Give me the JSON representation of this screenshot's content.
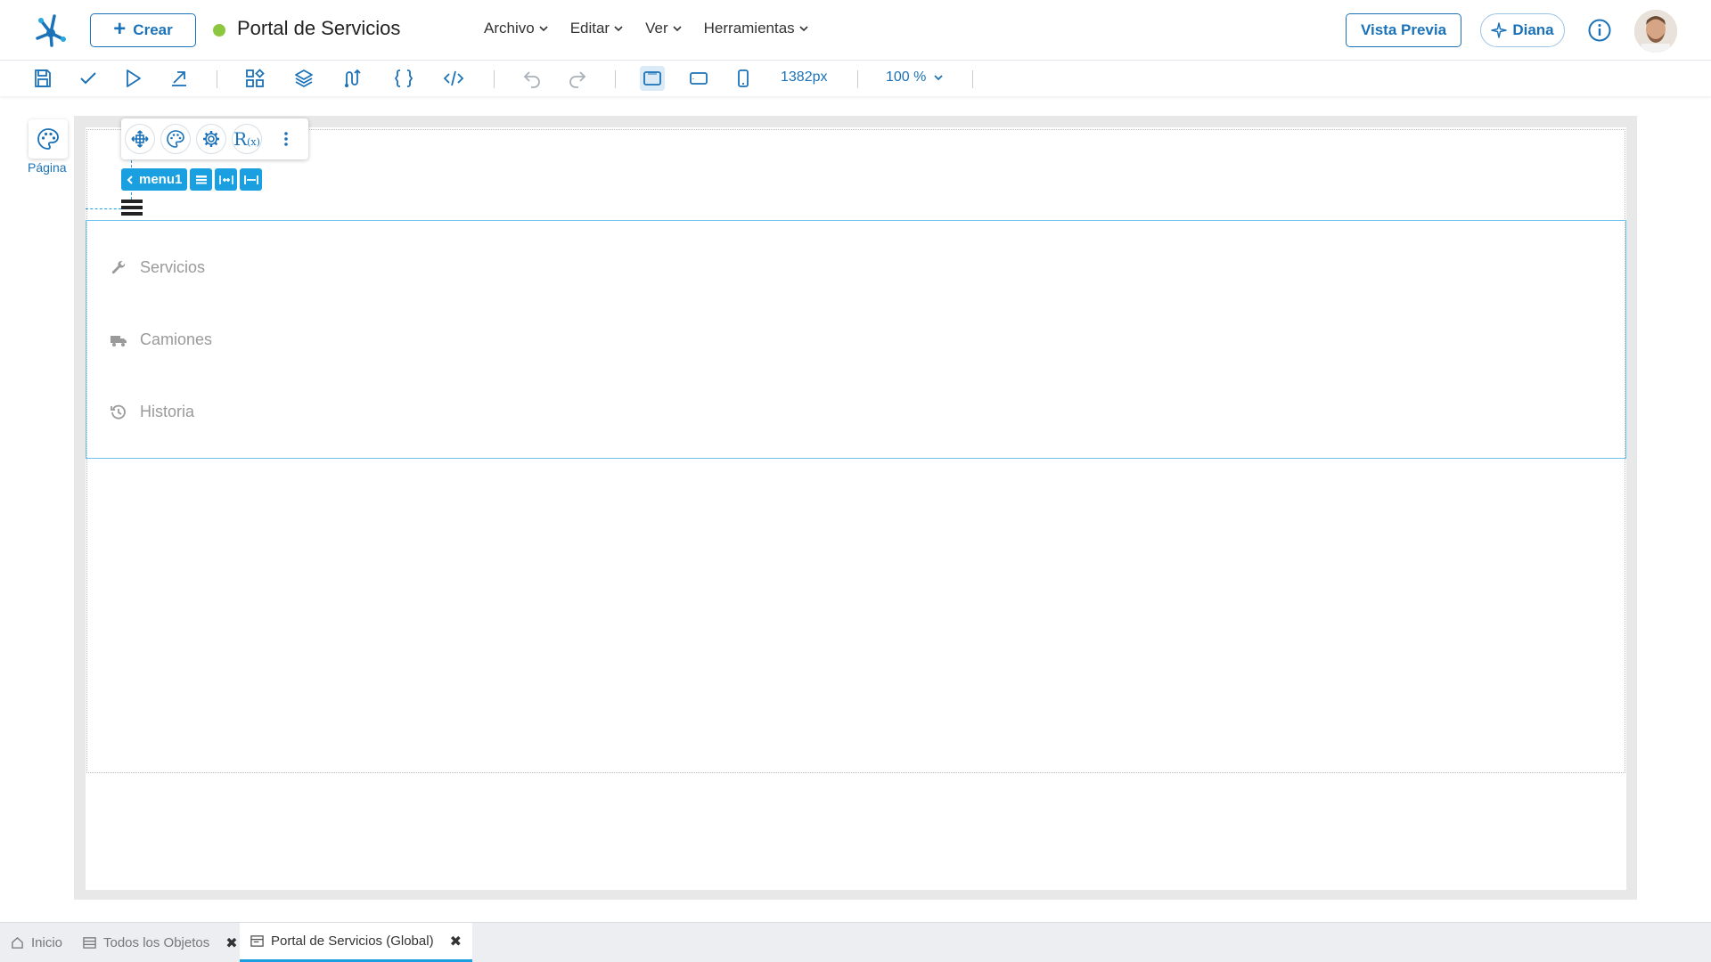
{
  "header": {
    "create_label": "Crear",
    "title": "Portal de Servicios",
    "status_color": "#8dc63f",
    "menus": [
      {
        "label": "Archivo"
      },
      {
        "label": "Editar"
      },
      {
        "label": "Ver"
      },
      {
        "label": "Herramientas"
      }
    ],
    "preview_label": "Vista Previa",
    "assistant_label": "Diana"
  },
  "toolbar": {
    "width_value": "1382px",
    "zoom_value": "100 %",
    "icons": [
      "save-icon",
      "check-icon",
      "play-icon",
      "export-icon",
      "widgets-icon",
      "layers-icon",
      "flow-icon",
      "braces-icon",
      "code-icon",
      "undo-icon",
      "redo-icon",
      "desktop-view-icon",
      "tablet-view-icon",
      "mobile-view-icon"
    ]
  },
  "left_panel": {
    "page_label": "Página"
  },
  "selection": {
    "name": "menu1"
  },
  "menu": {
    "items": [
      {
        "label": "Servicios",
        "icon": "wrench-icon"
      },
      {
        "label": "Camiones",
        "icon": "truck-icon"
      },
      {
        "label": "Historia",
        "icon": "history-icon"
      }
    ]
  },
  "bottom_tabs": [
    {
      "label": "Inicio"
    },
    {
      "label": "Todos los Objetos"
    },
    {
      "label": "Portal de Servicios (Global)"
    }
  ],
  "colors": {
    "accent": "#1b72b8",
    "selection": "#1aa0e0"
  }
}
